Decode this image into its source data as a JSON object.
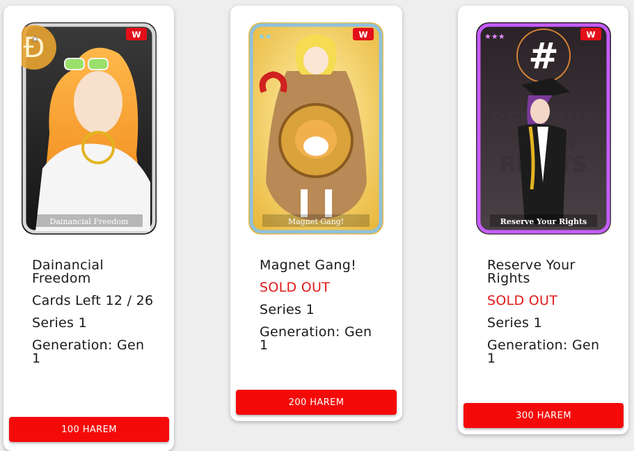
{
  "cards": [
    {
      "art_caption": "Dainancial Freedom",
      "stars": "★",
      "badge": "W",
      "name": "Dainancial Freedom",
      "cards_left": "Cards Left 12 / 26",
      "series": "Series 1",
      "generation": "Generation: Gen 1",
      "button": "100 HAREM",
      "frame_color": "#c9c9c9"
    },
    {
      "art_caption": "Magnet Gang!",
      "stars": "★★",
      "badge": "W",
      "name": "Magnet Gang!",
      "status": "SOLD OUT",
      "series": "Series 1",
      "generation": "Generation: Gen 1",
      "button": "200 HAREM",
      "frame_color": "#7fb7d6"
    },
    {
      "art_caption": "Reserve Your Rights",
      "stars": "★★★",
      "badge": "W",
      "name": "Reserve Your Rights",
      "status": "SOLD OUT",
      "series": "Series 1",
      "generation": "Generation: Gen 1",
      "button": "300 HAREM",
      "frame_color": "#c65cff"
    }
  ],
  "colors": {
    "accent": "#f50a0a",
    "sold_out": "#e01a1a"
  }
}
